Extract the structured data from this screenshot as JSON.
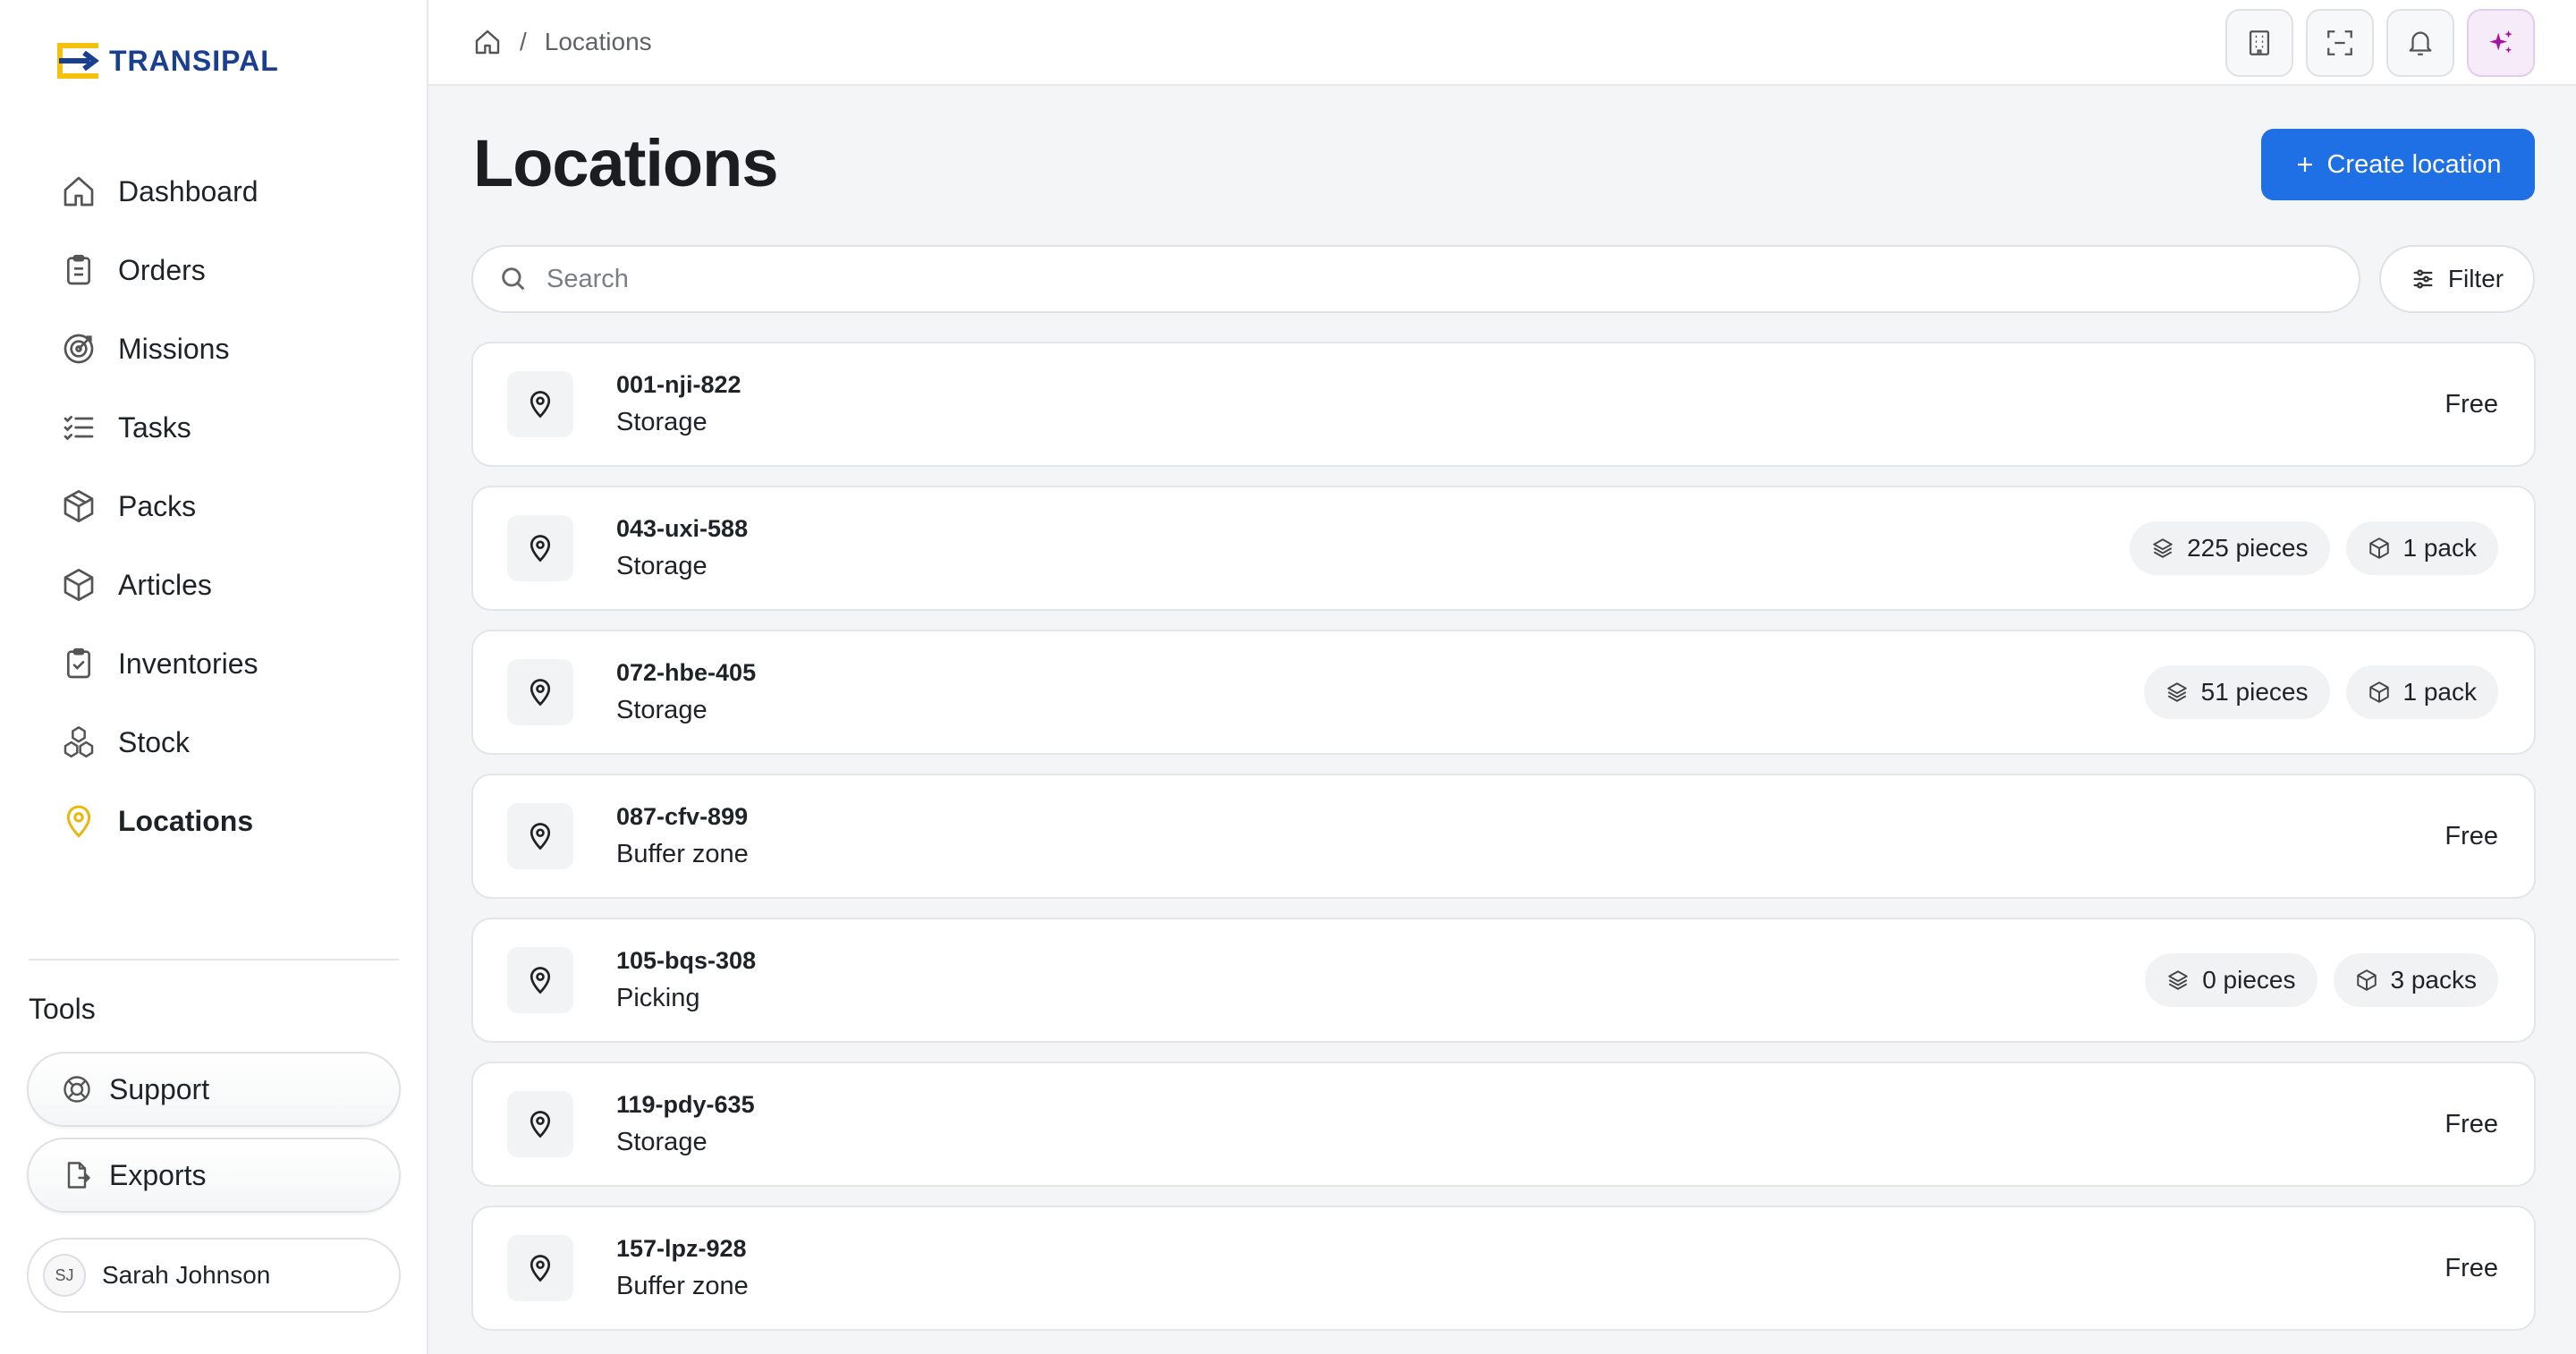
{
  "brand": {
    "name": "TRANSIPAL",
    "colors": {
      "blue": "#1b3f8f",
      "yellow": "#f4c20d"
    }
  },
  "sidebar": {
    "items": [
      {
        "label": "Dashboard",
        "icon": "home-icon"
      },
      {
        "label": "Orders",
        "icon": "clipboard-icon"
      },
      {
        "label": "Missions",
        "icon": "target-icon"
      },
      {
        "label": "Tasks",
        "icon": "checklist-icon"
      },
      {
        "label": "Packs",
        "icon": "box-icon"
      },
      {
        "label": "Articles",
        "icon": "cube-icon"
      },
      {
        "label": "Inventories",
        "icon": "clipboard-check-icon"
      },
      {
        "label": "Stock",
        "icon": "boxes-icon"
      },
      {
        "label": "Locations",
        "icon": "map-pin-icon",
        "active": true
      }
    ],
    "tools_title": "Tools",
    "tools": [
      {
        "label": "Support",
        "icon": "lifebuoy-icon"
      },
      {
        "label": "Exports",
        "icon": "file-export-icon"
      }
    ],
    "user": {
      "initials": "SJ",
      "name": "Sarah Johnson"
    }
  },
  "topbar": {
    "breadcrumb_separator": "/",
    "breadcrumb_current": "Locations"
  },
  "main": {
    "title": "Locations",
    "create_button": "Create location",
    "search_placeholder": "Search",
    "filter_button": "Filter",
    "accent_color": "#1f6fe5"
  },
  "locations": [
    {
      "code": "001-nji-822",
      "type": "Storage",
      "status": "Free"
    },
    {
      "code": "043-uxi-588",
      "type": "Storage",
      "pieces": "225 pieces",
      "packs": "1 pack"
    },
    {
      "code": "072-hbe-405",
      "type": "Storage",
      "pieces": "51 pieces",
      "packs": "1 pack"
    },
    {
      "code": "087-cfv-899",
      "type": "Buffer zone",
      "status": "Free"
    },
    {
      "code": "105-bqs-308",
      "type": "Picking",
      "pieces": "0 pieces",
      "packs": "3 packs"
    },
    {
      "code": "119-pdy-635",
      "type": "Storage",
      "status": "Free"
    },
    {
      "code": "157-lpz-928",
      "type": "Buffer zone",
      "status": "Free"
    }
  ]
}
